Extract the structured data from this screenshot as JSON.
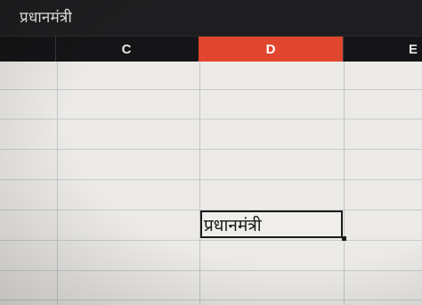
{
  "formula_bar": {
    "value": "प्रधानमंत्री"
  },
  "columns": {
    "c": "C",
    "d": "D",
    "e": "E"
  },
  "selected_column": "D",
  "active_cell": {
    "value": "प्रधानमंत्री"
  },
  "colors": {
    "selected_header": "#e0452d",
    "header_background": "#151517",
    "grid_background": "#eceae6"
  }
}
